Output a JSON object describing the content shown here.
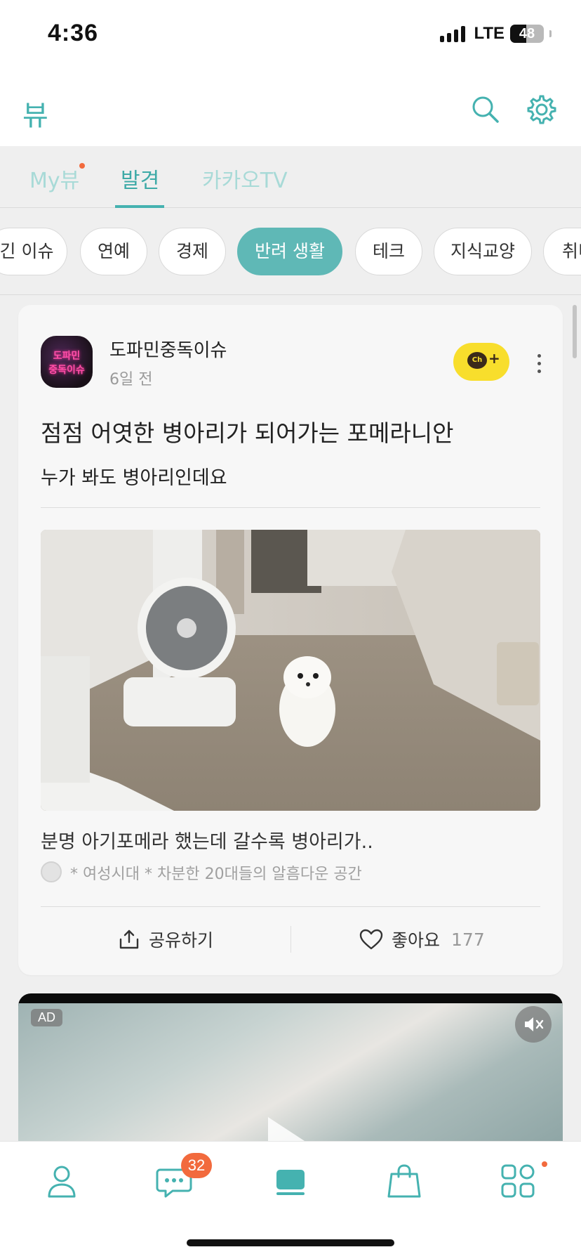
{
  "status_bar": {
    "time": "4:36",
    "network": "LTE",
    "battery": "48",
    "battery_level": 0.48
  },
  "header": {
    "title": "뷰",
    "icons": [
      "search-icon",
      "settings-gear-icon"
    ]
  },
  "tabs": [
    {
      "label": "My뷰",
      "has_dot": true
    },
    {
      "label": "발견",
      "active": true
    },
    {
      "label": "카카오TV"
    }
  ],
  "chips": [
    {
      "label": "긴 이슈"
    },
    {
      "label": "연예"
    },
    {
      "label": "경제"
    },
    {
      "label": "반려 생활",
      "active": true
    },
    {
      "label": "테크"
    },
    {
      "label": "지식교양"
    },
    {
      "label": "취미"
    }
  ],
  "post": {
    "avatar_text_1": "도파민",
    "avatar_text_2": "중독이슈",
    "channel_name": "도파민중독이슈",
    "time": "6일 전",
    "channel_add_icon": "ch-plus-icon",
    "headline": "점점 어엿한 병아리가 되어가는 포메라니안",
    "subheadline": "누가 봐도 병아리인데요",
    "caption": "분명 아기포메라 했는데 갈수록 병아리가..",
    "source": "* 여성시대 *  차분한 20대들의 알흠다운 공간",
    "share_label": "공유하기",
    "like_label": "좋아요",
    "like_count": "177"
  },
  "ad": {
    "badge": "AD",
    "icons": [
      "mute-icon",
      "play-icon"
    ]
  },
  "bottom_nav": {
    "items": [
      "profile-icon",
      "chat-icon",
      "view-icon",
      "shopping-icon",
      "more-apps-icon"
    ],
    "chat_badge": "32",
    "active_index": 2
  },
  "colors": {
    "accent": "#45b2b0",
    "chip_active": "#5fb8b6",
    "badge": "#f26a3d",
    "channel_yellow": "#f8de2c"
  }
}
